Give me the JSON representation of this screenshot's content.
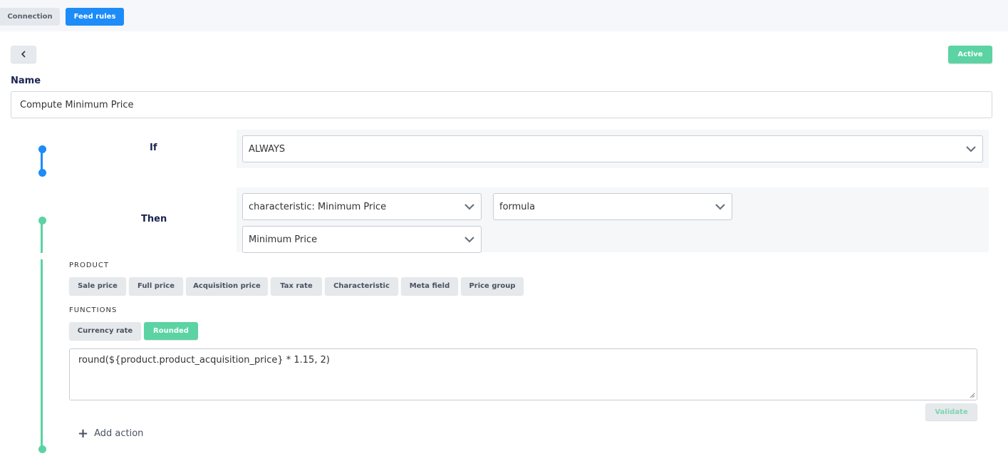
{
  "tabs": [
    {
      "label": "Connection",
      "active": false
    },
    {
      "label": "Feed rules",
      "active": true
    }
  ],
  "status": {
    "label": "Active",
    "color": "#5bd3a3"
  },
  "name_field": {
    "label": "Name",
    "value": "Compute Minimum Price"
  },
  "if_block": {
    "label": "If",
    "condition": "ALWAYS"
  },
  "then_block": {
    "label": "Then",
    "target_select": "characteristic: Minimum Price",
    "mode_select": "formula",
    "characteristic_select": "Minimum Price"
  },
  "product_section": {
    "title": "PRODUCT",
    "chips": [
      "Sale price",
      "Full price",
      "Acquisition price",
      "Tax rate",
      "Characteristic",
      "Meta field",
      "Price group"
    ]
  },
  "functions_section": {
    "title": "FUNCTIONS",
    "chips": [
      "Currency rate",
      "Rounded"
    ]
  },
  "formula": "round(${product.product_acquisition_price} * 1.15, 2)",
  "validate_label": "Validate",
  "add_action_label": "Add action",
  "colors": {
    "accent_blue": "#1d8cf8",
    "accent_green": "#5bd3a3",
    "heading": "#1b2350"
  },
  "icons": [
    "chevron-left-icon",
    "chevron-down-icon",
    "plus-icon",
    "resize-handle-icon"
  ]
}
